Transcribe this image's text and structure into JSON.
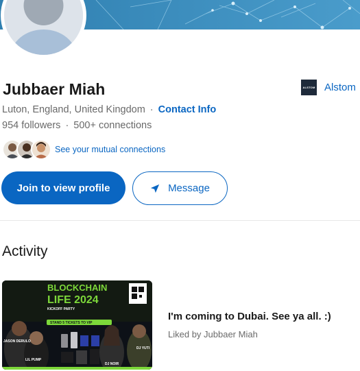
{
  "profile": {
    "name": "Jubbaer Miah",
    "location": "Luton, England, United Kingdom",
    "contact_info_label": "Contact Info",
    "followers": "954 followers",
    "connections": "500+ connections",
    "separator": "·",
    "mutual_connections_label": "See your mutual connections"
  },
  "company": {
    "name": "Alstom",
    "logo_text": "ALSTOM"
  },
  "actions": {
    "join_label": "Join to view profile",
    "message_label": "Message"
  },
  "activity": {
    "heading": "Activity",
    "post": {
      "thumbnail": {
        "headline_line1": "BLOCKCHAIN",
        "headline_line2": "LIFE 2024",
        "subtitle": "KICKOFF PARTY",
        "cta": "STAND 5 TICKETS TO VIP",
        "name_left": "JASON DERULO",
        "name_mid": "LIL PUMP",
        "name_right": "DJ YUTI",
        "name_right2": "DJ NOIR"
      },
      "title": "I'm coming to Dubai. See ya all. :)",
      "subtitle": "Liked by Jubbaer Miah"
    }
  },
  "colors": {
    "primary": "#0a66c2",
    "banner": "#3a8ab8",
    "text_secondary": "#666666"
  },
  "icons": {
    "message": "send-icon",
    "avatar": "person-placeholder-icon"
  }
}
